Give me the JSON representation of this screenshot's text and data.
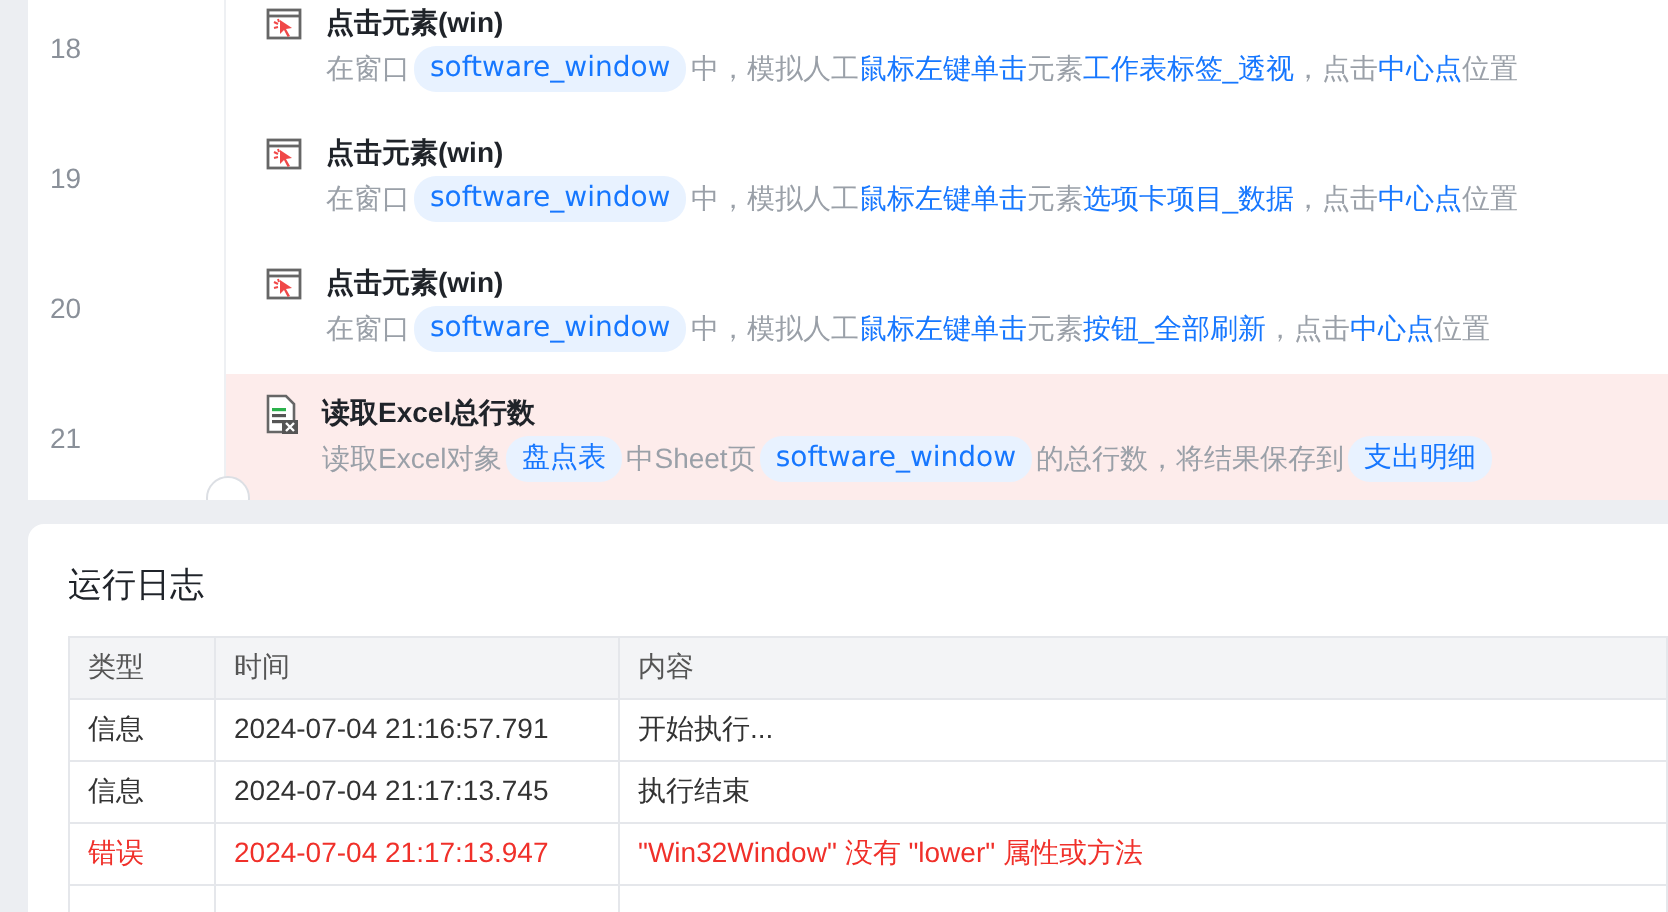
{
  "steps": [
    {
      "line": "18",
      "kind": "click",
      "selected": false,
      "title": "点击元素(win)",
      "segments": [
        {
          "kind": "text",
          "text": "在窗口"
        },
        {
          "kind": "chip",
          "text": "software_window"
        },
        {
          "kind": "text",
          "text": "中，模拟人工"
        },
        {
          "kind": "link",
          "text": "鼠标左键单击"
        },
        {
          "kind": "text",
          "text": "元素"
        },
        {
          "kind": "link",
          "text": "工作表标签_透视"
        },
        {
          "kind": "text",
          "text": "，点击"
        },
        {
          "kind": "link",
          "text": "中心点"
        },
        {
          "kind": "text",
          "text": "位置"
        }
      ]
    },
    {
      "line": "19",
      "kind": "click",
      "selected": false,
      "title": "点击元素(win)",
      "segments": [
        {
          "kind": "text",
          "text": "在窗口"
        },
        {
          "kind": "chip",
          "text": "software_window"
        },
        {
          "kind": "text",
          "text": "中，模拟人工"
        },
        {
          "kind": "link",
          "text": "鼠标左键单击"
        },
        {
          "kind": "text",
          "text": "元素"
        },
        {
          "kind": "link",
          "text": "选项卡项目_数据"
        },
        {
          "kind": "text",
          "text": "，点击"
        },
        {
          "kind": "link",
          "text": "中心点"
        },
        {
          "kind": "text",
          "text": "位置"
        }
      ]
    },
    {
      "line": "20",
      "kind": "click",
      "selected": false,
      "title": "点击元素(win)",
      "segments": [
        {
          "kind": "text",
          "text": "在窗口"
        },
        {
          "kind": "chip",
          "text": "software_window"
        },
        {
          "kind": "text",
          "text": "中，模拟人工"
        },
        {
          "kind": "link",
          "text": "鼠标左键单击"
        },
        {
          "kind": "text",
          "text": "元素"
        },
        {
          "kind": "link",
          "text": "按钮_全部刷新"
        },
        {
          "kind": "text",
          "text": "，点击"
        },
        {
          "kind": "link",
          "text": "中心点"
        },
        {
          "kind": "text",
          "text": "位置"
        }
      ]
    },
    {
      "line": "21",
      "kind": "excel",
      "selected": true,
      "title": "读取Excel总行数",
      "segments": [
        {
          "kind": "text",
          "text": "读取Excel对象"
        },
        {
          "kind": "chip",
          "text": "盘点表"
        },
        {
          "kind": "text",
          "text": "中Sheet页"
        },
        {
          "kind": "chip",
          "text": "software_window"
        },
        {
          "kind": "text",
          "text": "的总行数，将结果保存到"
        },
        {
          "kind": "chip",
          "text": "支出明细"
        }
      ]
    }
  ],
  "log": {
    "title": "运行日志",
    "columns": [
      "类型",
      "时间",
      "内容"
    ],
    "rows": [
      {
        "error": false,
        "cells": [
          "信息",
          "2024-07-04 21:16:57.791",
          "开始执行..."
        ]
      },
      {
        "error": false,
        "cells": [
          "信息",
          "2024-07-04 21:17:13.745",
          "执行结束"
        ]
      },
      {
        "error": true,
        "cells": [
          "错误",
          "2024-07-04 21:17:13.947",
          "\"Win32Window\" 没有 \"lower\" 属性或方法"
        ]
      }
    ]
  }
}
